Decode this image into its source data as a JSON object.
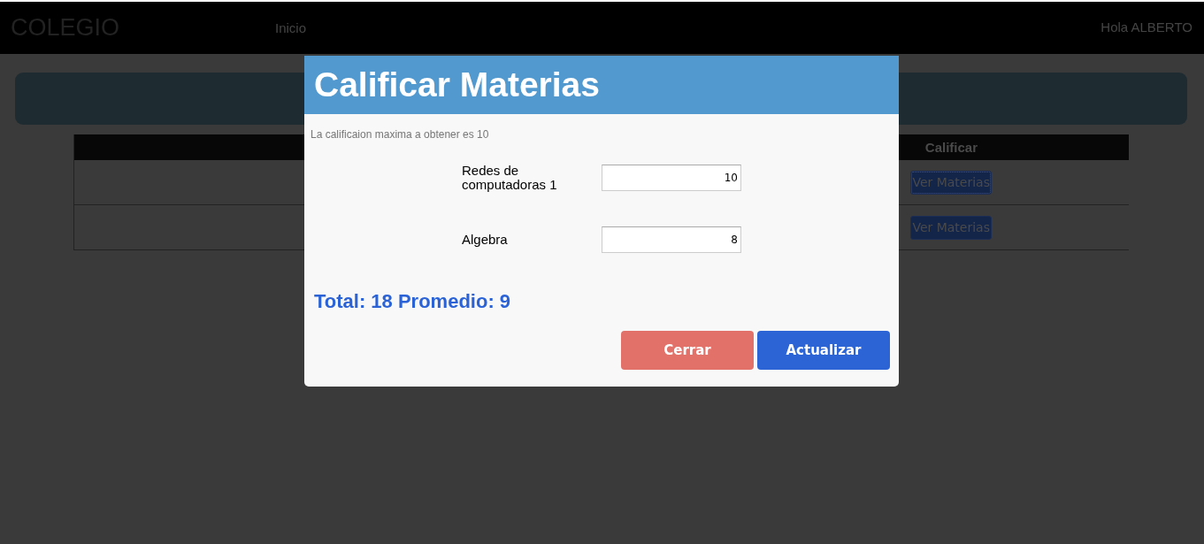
{
  "navbar": {
    "brand": "COLEGIO",
    "links": [
      "Inicio"
    ],
    "greeting": "Hola ALBERTO"
  },
  "table": {
    "columns": [
      "Calificar"
    ],
    "rows": [
      {
        "action": "Ver Materias",
        "focused": true
      },
      {
        "action": "Ver Materias",
        "focused": false
      }
    ]
  },
  "modal": {
    "title": "Calificar Materias",
    "note": "La calificaion maxima a obtener es 10",
    "subjects": [
      {
        "name": "Redes de computadoras 1",
        "grade": "10"
      },
      {
        "name": "Algebra",
        "grade": "8"
      }
    ],
    "summary": "Total: 18 Promedio: 9",
    "buttons": [
      {
        "label": "Cerrar",
        "kind": "danger"
      },
      {
        "label": "Actualizar",
        "kind": "primary"
      }
    ]
  }
}
